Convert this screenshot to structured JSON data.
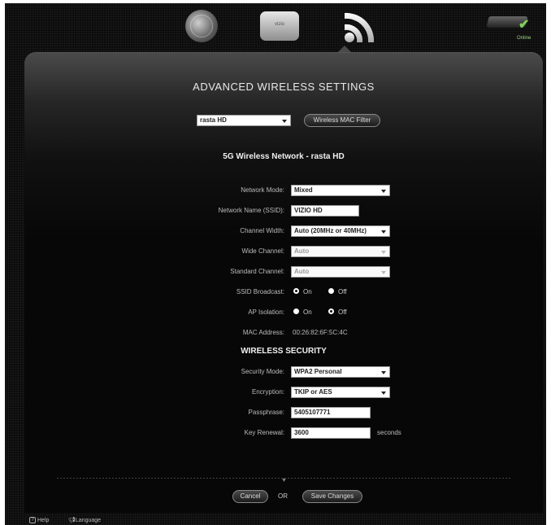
{
  "header": {
    "router_label": "vizio",
    "status_text": "Online",
    "icons": [
      "globe-icon",
      "router-icon",
      "wireless-icon",
      "modem-icon",
      "check-icon"
    ]
  },
  "page": {
    "title": "ADVANCED WIRELESS SETTINGS",
    "network_select": {
      "value": "rasta HD"
    },
    "mac_filter_label": "Wireless MAC Filter",
    "network_heading": "5G Wireless Network  -  rasta HD"
  },
  "wireless": {
    "network_mode": {
      "label": "Network Mode:",
      "value": "Mixed"
    },
    "ssid": {
      "label": "Network Name (SSID):",
      "value": "VIZIO HD"
    },
    "channel_width": {
      "label": "Channel Width:",
      "value": "Auto (20MHz or 40MHz)"
    },
    "wide_channel": {
      "label": "Wide Channel:",
      "value": "Auto"
    },
    "standard_channel": {
      "label": "Standard Channel:",
      "value": "Auto"
    },
    "ssid_broadcast": {
      "label": "SSID Broadcast:",
      "on_label": "On",
      "off_label": "Off",
      "selected": "On"
    },
    "ap_isolation": {
      "label": "AP Isolation:",
      "on_label": "On",
      "off_label": "Off",
      "selected": "Off"
    },
    "mac_address": {
      "label": "MAC Address:",
      "value": "00:26:82:6F:5C:4C"
    }
  },
  "security": {
    "heading": "WIRELESS SECURITY",
    "security_mode": {
      "label": "Security Mode:",
      "value": "WPA2 Personal"
    },
    "encryption": {
      "label": "Encryption:",
      "value": "TKIP or AES"
    },
    "passphrase": {
      "label": "Passphrase:",
      "value": "5405107771"
    },
    "key_renewal": {
      "label": "Key Renewal:",
      "value": "3600",
      "unit": "seconds"
    }
  },
  "actions": {
    "cancel_label": "Cancel",
    "or_label": "OR",
    "save_label": "Save Changes"
  },
  "footer": {
    "help_label": "Help",
    "language_label": "Language"
  },
  "colors": {
    "background": "#0c0c0c",
    "status_green": "#7fd35a",
    "text": "#dddddd"
  }
}
